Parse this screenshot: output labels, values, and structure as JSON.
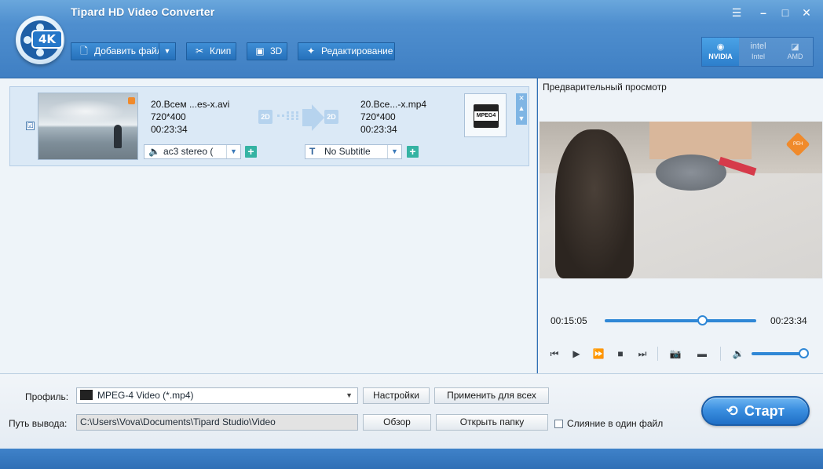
{
  "app": {
    "title": "Tipard HD Video Converter",
    "logo_badge": "4K"
  },
  "window_controls": {
    "menu": "☰",
    "minimize": "–",
    "maximize": "□",
    "close": "✕"
  },
  "toolbar": {
    "add_file_label": "Добавить файл",
    "add_file_dropdown": "▼",
    "clip_label": "Клип",
    "threed_label": "3D",
    "edit_label": "Редактирование"
  },
  "gpu": {
    "nvidia": "NVIDIA",
    "intel_logo": "intel",
    "intel": "Intel",
    "amd": "AMD"
  },
  "file": {
    "checked": "☑",
    "source_name": "20.Всем ...es-x.avi",
    "source_resolution": "720*400",
    "source_duration": "00:23:34",
    "tag_in": "2D",
    "tag_out": "2D",
    "target_name": "20.Все...-x.mp4",
    "target_resolution": "720*400",
    "target_duration": "00:23:34",
    "audio_track": "ac3 stereo (",
    "subtitle": "No Subtitle",
    "format_badge": "MPEG4",
    "add_audio": "+",
    "add_subtitle": "+"
  },
  "preview": {
    "label": "Предварительный просмотр",
    "current_time": "00:15:05",
    "total_time": "00:23:34",
    "progress_pct": 64,
    "volume_pct": 100
  },
  "bottom": {
    "profile_label": "Профиль:",
    "profile_value": "MPEG-4 Video (*.mp4)",
    "settings_button": "Настройки",
    "apply_all_button": "Применить для всех",
    "output_label": "Путь вывода:",
    "output_path": "C:\\Users\\Vova\\Documents\\Tipard Studio\\Video",
    "browse_button": "Обзор",
    "open_folder_button": "Открыть папку",
    "merge_label": "Слияние в один файл",
    "start_button": "Старт"
  },
  "colors": {
    "accent": "#2f87d6",
    "toolbar": "#3f7fc3",
    "plus": "#35b3a3"
  }
}
